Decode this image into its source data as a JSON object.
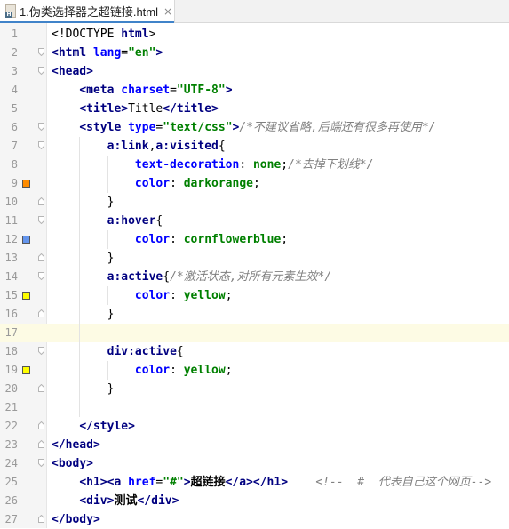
{
  "tab": {
    "filename": "1.伪类选择器之超链接.html",
    "icon_letter": "H",
    "close_glyph": "×"
  },
  "swatch_colors": {
    "9": "#ff8c00",
    "12": "#6495ed",
    "15": "#ffff00",
    "19": "#ffff00"
  },
  "current_line": 17,
  "lines": [
    {
      "n": "1",
      "tokens": [
        [
          "pun",
          "<!DOCTYPE "
        ],
        [
          "tag",
          "html"
        ],
        [
          "pun",
          ">"
        ]
      ]
    },
    {
      "n": "2",
      "tokens": [
        [
          "tag",
          "<html "
        ],
        [
          "attr",
          "lang"
        ],
        [
          "pun",
          "="
        ],
        [
          "str",
          "\"en\""
        ],
        [
          "tag",
          ">"
        ]
      ]
    },
    {
      "n": "3",
      "tokens": [
        [
          "tag",
          "<head>"
        ]
      ]
    },
    {
      "n": "4",
      "tokens": [
        [
          "txt",
          "    "
        ],
        [
          "tag",
          "<meta "
        ],
        [
          "attr",
          "charset"
        ],
        [
          "pun",
          "="
        ],
        [
          "str",
          "\"UTF-8\""
        ],
        [
          "tag",
          ">"
        ]
      ]
    },
    {
      "n": "5",
      "tokens": [
        [
          "txt",
          "    "
        ],
        [
          "tag",
          "<title>"
        ],
        [
          "txt",
          "Title"
        ],
        [
          "tag",
          "</title>"
        ]
      ]
    },
    {
      "n": "6",
      "tokens": [
        [
          "txt",
          "    "
        ],
        [
          "tag",
          "<style "
        ],
        [
          "attr",
          "type"
        ],
        [
          "pun",
          "="
        ],
        [
          "str",
          "\"text/css\""
        ],
        [
          "tag",
          ">"
        ],
        [
          "cmt",
          "/*不建议省略,后端还有很多再使用*/"
        ]
      ]
    },
    {
      "n": "7",
      "tokens": [
        [
          "txt",
          "        "
        ],
        [
          "sel",
          "a:link"
        ],
        [
          "pun",
          ","
        ],
        [
          "sel",
          "a:visited"
        ],
        [
          "pun",
          "{"
        ]
      ]
    },
    {
      "n": "8",
      "tokens": [
        [
          "txt",
          "            "
        ],
        [
          "prop",
          "text-decoration"
        ],
        [
          "pun",
          ": "
        ],
        [
          "val",
          "none"
        ],
        [
          "pun",
          ";"
        ],
        [
          "cmt",
          "/*去掉下划线*/"
        ]
      ]
    },
    {
      "n": "9",
      "tokens": [
        [
          "txt",
          "            "
        ],
        [
          "prop",
          "color"
        ],
        [
          "pun",
          ": "
        ],
        [
          "val",
          "darkorange"
        ],
        [
          "pun",
          ";"
        ]
      ]
    },
    {
      "n": "10",
      "tokens": [
        [
          "txt",
          "        "
        ],
        [
          "pun",
          "}"
        ]
      ]
    },
    {
      "n": "11",
      "tokens": [
        [
          "txt",
          "        "
        ],
        [
          "sel",
          "a:hover"
        ],
        [
          "pun",
          "{"
        ]
      ]
    },
    {
      "n": "12",
      "tokens": [
        [
          "txt",
          "            "
        ],
        [
          "prop",
          "color"
        ],
        [
          "pun",
          ": "
        ],
        [
          "val",
          "cornflowerblue"
        ],
        [
          "pun",
          ";"
        ]
      ]
    },
    {
      "n": "13",
      "tokens": [
        [
          "txt",
          "        "
        ],
        [
          "pun",
          "}"
        ]
      ]
    },
    {
      "n": "14",
      "tokens": [
        [
          "txt",
          "        "
        ],
        [
          "sel",
          "a:active"
        ],
        [
          "pun",
          "{"
        ],
        [
          "cmt",
          "/*激活状态,对所有元素生效*/"
        ]
      ]
    },
    {
      "n": "15",
      "tokens": [
        [
          "txt",
          "            "
        ],
        [
          "prop",
          "color"
        ],
        [
          "pun",
          ": "
        ],
        [
          "val",
          "yellow"
        ],
        [
          "pun",
          ";"
        ]
      ]
    },
    {
      "n": "16",
      "tokens": [
        [
          "txt",
          "        "
        ],
        [
          "pun",
          "}"
        ]
      ]
    },
    {
      "n": "17",
      "tokens": []
    },
    {
      "n": "18",
      "tokens": [
        [
          "txt",
          "        "
        ],
        [
          "sel",
          "div:active"
        ],
        [
          "pun",
          "{"
        ]
      ]
    },
    {
      "n": "19",
      "tokens": [
        [
          "txt",
          "            "
        ],
        [
          "prop",
          "color"
        ],
        [
          "pun",
          ": "
        ],
        [
          "val",
          "yellow"
        ],
        [
          "pun",
          ";"
        ]
      ]
    },
    {
      "n": "20",
      "tokens": [
        [
          "txt",
          "        "
        ],
        [
          "pun",
          "}"
        ]
      ]
    },
    {
      "n": "21",
      "tokens": []
    },
    {
      "n": "22",
      "tokens": [
        [
          "txt",
          "    "
        ],
        [
          "tag",
          "</style>"
        ]
      ]
    },
    {
      "n": "23",
      "tokens": [
        [
          "tag",
          "</head>"
        ]
      ]
    },
    {
      "n": "24",
      "tokens": [
        [
          "tag",
          "<body>"
        ]
      ]
    },
    {
      "n": "25",
      "tokens": [
        [
          "txt",
          "    "
        ],
        [
          "tag",
          "<h1><a "
        ],
        [
          "attr",
          "href"
        ],
        [
          "pun",
          "="
        ],
        [
          "str",
          "\"#\""
        ],
        [
          "tag",
          ">"
        ],
        [
          "cjk",
          "超链接"
        ],
        [
          "tag",
          "</a></h1>"
        ],
        [
          "txt",
          "    "
        ],
        [
          "cmt",
          "<!--  #  代表自己这个网页-->"
        ]
      ]
    },
    {
      "n": "26",
      "tokens": [
        [
          "txt",
          "    "
        ],
        [
          "tag",
          "<div>"
        ],
        [
          "cjk",
          "测试"
        ],
        [
          "tag",
          "</div>"
        ]
      ]
    },
    {
      "n": "27",
      "tokens": [
        [
          "tag",
          "</body>"
        ]
      ]
    }
  ],
  "fold_markers": {
    "2": "open",
    "3": "open",
    "6": "open",
    "7": "open",
    "10": "close",
    "11": "open",
    "13": "close",
    "14": "open",
    "16": "close",
    "18": "open",
    "20": "close",
    "22": "close",
    "23": "close",
    "24": "open",
    "27": "close"
  }
}
